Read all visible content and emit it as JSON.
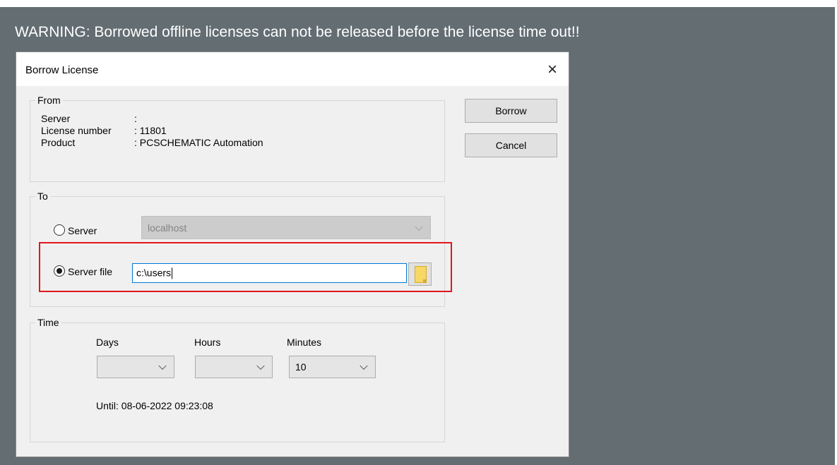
{
  "warning": "WARNING: Borrowed offline licenses can not be released before the license time out!!",
  "dialog": {
    "title": "Borrow License",
    "close_icon": "×"
  },
  "from": {
    "label": "From",
    "rows": [
      {
        "key": "Server",
        "value": ":"
      },
      {
        "key": "License number",
        "value": ": 11801"
      },
      {
        "key": "Product",
        "value": ": PCSCHEMATIC Automation"
      }
    ]
  },
  "buttons": {
    "borrow": "Borrow",
    "cancel": "Cancel"
  },
  "to": {
    "label": "To",
    "server_option": "Server",
    "server_select_value": "localhost",
    "server_file_option": "Server file",
    "server_file_value": "c:\\users",
    "selected": "server_file"
  },
  "time": {
    "label": "Time",
    "days_label": "Days",
    "hours_label": "Hours",
    "minutes_label": "Minutes",
    "days_value": "",
    "hours_value": "",
    "minutes_value": "10",
    "until": "Until: 08-06-2022 09:23:08"
  },
  "colors": {
    "backdrop": "#636d72",
    "highlight": "#e0161c",
    "focus_border": "#0078d7"
  }
}
